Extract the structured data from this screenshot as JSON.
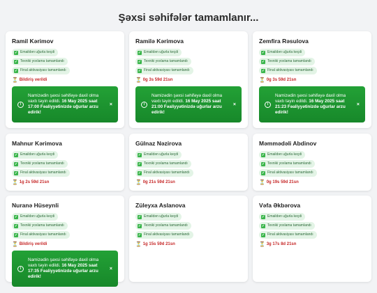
{
  "page_title": "Şəxsi səhifələr tamamlanır...",
  "icons": {
    "check": "check-icon",
    "hourglass": "hourglass-icon",
    "info": "info-icon",
    "close": "close-icon"
  },
  "colors": {
    "toast": "#1e8e2e",
    "step_bg": "#e3f4e6",
    "status_red": "#c62828"
  },
  "cards": [
    {
      "name": "Ramil Kərimov",
      "steps": [
        "Emaildən uğurla keçdi",
        "Texniki yoxlama tamamlandı",
        "Final aktivasiyası tamamlandı"
      ],
      "status_text": "Bildiriş verildi",
      "status_type": "notified",
      "toast": {
        "pre": "Namizədin şəxsi səhifəyə daxil olma vaxtı təyin edildi.",
        "bold": "16 May 2025 saat 17:00 Fəaliyyətinizdə uğurlar arzu edirik!"
      }
    },
    {
      "name": "Ramilə Kərimova",
      "steps": [
        "Emaildən uğurla keçdi",
        "Texniki yoxlama tamamlandı",
        "Final aktivasiyası tamamlandı"
      ],
      "status_text": "0g 3s 59d 21sn",
      "status_type": "timer",
      "toast": {
        "pre": "Namizədin şəxsi səhifəyə daxil olma vaxtı təyin edildi.",
        "bold": "16 May 2025 saat 21:00 Fəaliyyətinizdə uğurlar arzu edirik!"
      }
    },
    {
      "name": "Zemfira Rəsulova",
      "steps": [
        "Emaildən uğurla keçdi",
        "Texniki yoxlama tamamlandı",
        "Final aktivasiyası tamamlandı"
      ],
      "status_text": "0g 3s 59d 21sn",
      "status_type": "timer",
      "toast": {
        "pre": "Namizədin şəxsi səhifəyə daxil olma vaxtı təyin edildi.",
        "bold": "16 May 2025 saat 21:23 Fəaliyyətinizdə uğurlar arzu edirik!"
      }
    },
    {
      "name": "Mahnur Kərimova",
      "steps": [
        "Emaildən uğurla keçdi",
        "Texniki yoxlama tamamlandı",
        "Final aktivasiyası tamamlandı"
      ],
      "status_text": "1g 2s 59d 21sn",
      "status_type": "timer"
    },
    {
      "name": "Gülnaz Nəzirova",
      "steps": [
        "Emaildən uğurla keçdi",
        "Texniki yoxlama tamamlandı",
        "Final aktivasiyası tamamlandı"
      ],
      "status_text": "0g 21s 59d 21sn",
      "status_type": "timer"
    },
    {
      "name": "Məmmədəli Abdinov",
      "steps": [
        "Emaildən uğurla keçdi",
        "Texniki yoxlama tamamlandı",
        "Final aktivasiyası tamamlandı"
      ],
      "status_text": "0g 19s 59d 21sn",
      "status_type": "timer"
    },
    {
      "name": "Nuranə Hüseynli",
      "steps": [
        "Emaildən uğurla keçdi",
        "Texniki yoxlama tamamlandı",
        "Final aktivasiyası tamamlandı"
      ],
      "status_text": "Bildiriş verildi",
      "status_type": "notified",
      "toast": {
        "pre": "Namizədin şəxsi səhifəyə daxil olma vaxtı təyin edildi.",
        "bold": "16 May 2025 saat 17:35 Fəaliyyətinizdə uğurlar arzu edirik!"
      }
    },
    {
      "name": "Züleyxa Aslanova",
      "steps": [
        "Emaildən uğurla keçdi",
        "Texniki yoxlama tamamlandı",
        "Final aktivasiyası tamamlandı"
      ],
      "status_text": "1g 15s 59d 21sn",
      "status_type": "timer"
    },
    {
      "name": "Vəfa Əkbərova",
      "steps": [
        "Emaildən uğurla keçdi",
        "Texniki yoxlama tamamlandı",
        "Final aktivasiyası tamamlandı"
      ],
      "status_text": "3g 17s 8d 21sn",
      "status_type": "timer"
    }
  ]
}
